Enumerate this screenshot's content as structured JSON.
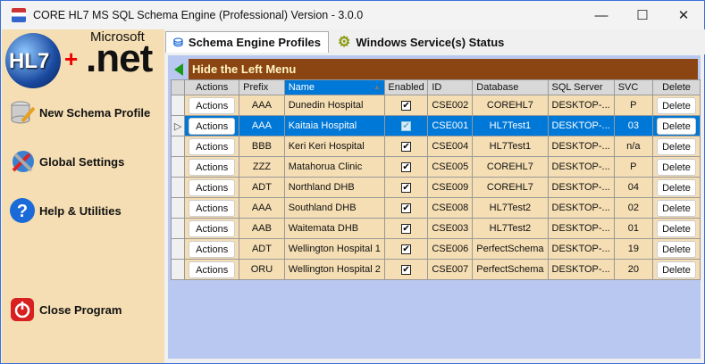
{
  "window": {
    "title": "CORE HL7 MS SQL Schema Engine (Professional) Version - 3.0.0",
    "minimize": "—",
    "maximize": "☐",
    "close": "✕"
  },
  "logo": {
    "hl7": "HL7",
    "plus": "+",
    "microsoft": "Microsoft",
    "net": ".net"
  },
  "sidebar": {
    "items": [
      {
        "label": "New Schema Profile",
        "icon": "database-pencil-icon"
      },
      {
        "label": "Global Settings",
        "icon": "globe-tools-icon"
      },
      {
        "label": "Help & Utilities",
        "icon": "help-icon"
      },
      {
        "label": "Close Program",
        "icon": "power-icon"
      }
    ]
  },
  "tabs": [
    {
      "label": "Schema Engine Profiles",
      "active": true
    },
    {
      "label": "Windows Service(s) Status",
      "active": false
    }
  ],
  "hide_menu_label": "Hide the Left Menu",
  "grid": {
    "columns": [
      "Actions",
      "Prefix",
      "Name",
      "Enabled",
      "ID",
      "Database",
      "SQL Server",
      "SVC",
      "Delete"
    ],
    "sorted_column": "Name",
    "action_label": "Actions",
    "delete_label": "Delete",
    "check": "✔",
    "rows": [
      {
        "prefix": "AAA",
        "name": "Dunedin Hospital",
        "enabled": true,
        "id": "CSE002",
        "database": "COREHL7",
        "server": "DESKTOP-...",
        "svc": "P"
      },
      {
        "prefix": "AAA",
        "name": "Kaitaia Hospital",
        "enabled": true,
        "id": "CSE001",
        "database": "HL7Test1",
        "server": "DESKTOP-...",
        "svc": "03",
        "selected": true
      },
      {
        "prefix": "BBB",
        "name": "Keri Keri Hospital",
        "enabled": true,
        "id": "CSE004",
        "database": "HL7Test1",
        "server": "DESKTOP-...",
        "svc": "n/a"
      },
      {
        "prefix": "ZZZ",
        "name": "Matahorua Clinic",
        "enabled": true,
        "id": "CSE005",
        "database": "COREHL7",
        "server": "DESKTOP-...",
        "svc": "P"
      },
      {
        "prefix": "ADT",
        "name": "Northland DHB",
        "enabled": true,
        "id": "CSE009",
        "database": "COREHL7",
        "server": "DESKTOP-...",
        "svc": "04"
      },
      {
        "prefix": "AAA",
        "name": "Southland DHB",
        "enabled": true,
        "id": "CSE008",
        "database": "HL7Test2",
        "server": "DESKTOP-...",
        "svc": "02"
      },
      {
        "prefix": "AAB",
        "name": "Waitemata DHB",
        "enabled": true,
        "id": "CSE003",
        "database": "HL7Test2",
        "server": "DESKTOP-...",
        "svc": "01"
      },
      {
        "prefix": "ADT",
        "name": "Wellington Hospital 1",
        "enabled": true,
        "id": "CSE006",
        "database": "PerfectSchema",
        "server": "DESKTOP-...",
        "svc": "19"
      },
      {
        "prefix": "ORU",
        "name": "Wellington Hospital 2",
        "enabled": true,
        "id": "CSE007",
        "database": "PerfectSchema",
        "server": "DESKTOP-...",
        "svc": "20"
      }
    ]
  },
  "colors": {
    "sidebar": "#f5deb3",
    "header_bar": "#8b4513",
    "selection": "#0078d7",
    "content_bg": "#b9c8f0"
  }
}
